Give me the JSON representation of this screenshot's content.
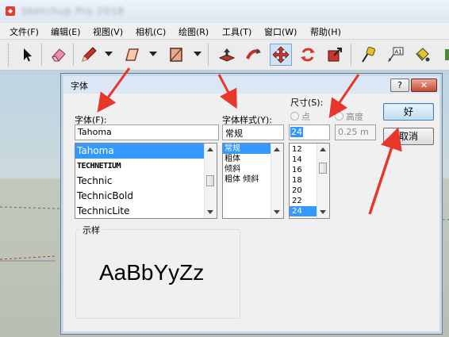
{
  "app": {
    "title": "Sketchup Pro 2018"
  },
  "menu": [
    "文件(F)",
    "编辑(E)",
    "视图(V)",
    "相机(C)",
    "绘图(R)",
    "工具(T)",
    "窗口(W)",
    "帮助(H)"
  ],
  "toolbar": {
    "tools": [
      "select",
      "eraser",
      "pencil",
      "rectangle",
      "push-pull",
      "follow-me",
      "move",
      "rotate",
      "scale",
      "tape-measure",
      "text",
      "paint-bucket"
    ]
  },
  "dialog": {
    "title": "字体",
    "help": "?",
    "close": "✕",
    "font": {
      "label": "字体(F):",
      "value": "Tahoma",
      "options": [
        "Tahoma",
        "TECHNETIUM",
        "Technic",
        "TechnicBold",
        "TechnicLite"
      ],
      "selected": "Tahoma"
    },
    "style": {
      "label": "字体样式(Y):",
      "value": "常规",
      "options": [
        "常规",
        "粗体",
        "倾斜",
        "粗体 倾斜"
      ],
      "selected": "常规"
    },
    "size": {
      "label": "尺寸(S):",
      "radio_points": "点",
      "radio_height": "高度",
      "value": "24",
      "height_value": "0.25 m",
      "options": [
        "12",
        "14",
        "16",
        "18",
        "20",
        "22",
        "24"
      ],
      "selected": "24"
    },
    "ok": "好",
    "cancel": "取消",
    "sample": {
      "label": "示样",
      "text": "AaBbYyZz"
    }
  },
  "colors": {
    "annotation_arrow": "#e8372a",
    "selection": "#3399ff",
    "default_button": "#3c7fb1"
  }
}
